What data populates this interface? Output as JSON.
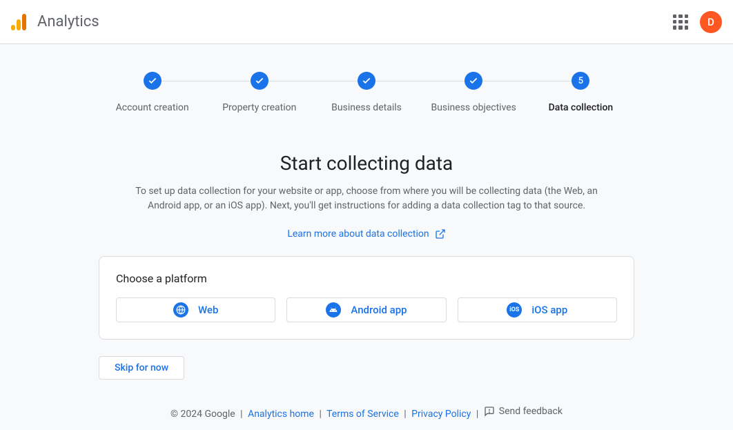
{
  "header": {
    "app_title": "Analytics",
    "avatar_letter": "D"
  },
  "stepper": {
    "steps": [
      {
        "label": "Account creation",
        "completed": true
      },
      {
        "label": "Property creation",
        "completed": true
      },
      {
        "label": "Business details",
        "completed": true
      },
      {
        "label": "Business objectives",
        "completed": true
      },
      {
        "label": "Data collection",
        "number": "5",
        "active": true
      }
    ]
  },
  "content": {
    "title": "Start collecting data",
    "description": "To set up data collection for your website or app, choose from where you will be collecting data (the Web, an Android app, or an iOS app). Next, you'll get instructions for adding a data collection tag to that source.",
    "learn_link": "Learn more about data collection"
  },
  "platform": {
    "title": "Choose a platform",
    "options": {
      "web": "Web",
      "android": "Android app",
      "ios": "iOS app"
    }
  },
  "actions": {
    "skip": "Skip for now"
  },
  "footer": {
    "copyright": "© 2024 Google",
    "analytics_home": "Analytics home",
    "terms": "Terms of Service",
    "privacy": "Privacy Policy",
    "feedback": "Send feedback"
  }
}
